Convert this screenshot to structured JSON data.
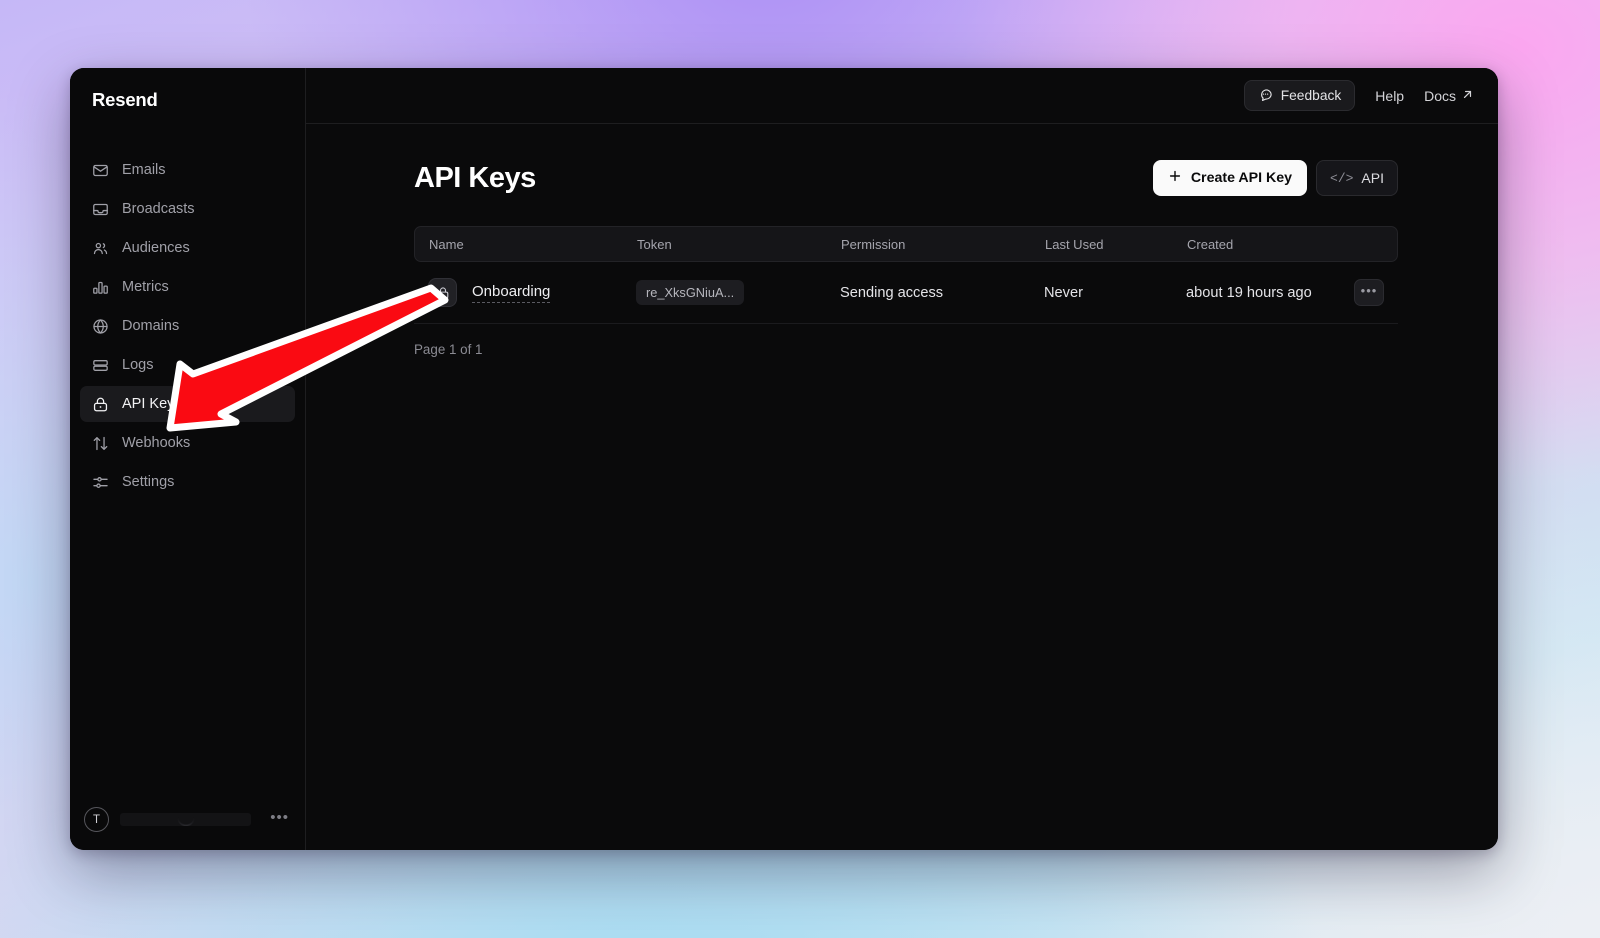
{
  "brand": {
    "name": "Resend"
  },
  "sidebar": {
    "items": [
      {
        "label": "Emails",
        "icon": "envelope-icon",
        "active": false
      },
      {
        "label": "Broadcasts",
        "icon": "inbox-icon",
        "active": false
      },
      {
        "label": "Audiences",
        "icon": "users-icon",
        "active": false
      },
      {
        "label": "Metrics",
        "icon": "bar-chart-icon",
        "active": false
      },
      {
        "label": "Domains",
        "icon": "globe-icon",
        "active": false
      },
      {
        "label": "Logs",
        "icon": "logs-icon",
        "active": false
      },
      {
        "label": "API Keys",
        "icon": "lock-icon",
        "active": true
      },
      {
        "label": "Webhooks",
        "icon": "arrows-updown-icon",
        "active": false
      },
      {
        "label": "Settings",
        "icon": "sliders-icon",
        "active": false
      }
    ],
    "footer": {
      "avatar_initial": "T",
      "account_name": "",
      "menu_label": "•••"
    }
  },
  "topbar": {
    "feedback_label": "Feedback",
    "feedback_icon": "chat-bubble-icon",
    "help_label": "Help",
    "docs_label": "Docs",
    "docs_icon": "external-link-icon"
  },
  "page": {
    "title": "API Keys",
    "create_button_label": "Create API Key",
    "create_button_icon": "plus-icon",
    "api_button_label": "API",
    "api_button_icon": "code-icon",
    "pagination": "Page 1 of 1"
  },
  "table": {
    "columns": [
      "Name",
      "Token",
      "Permission",
      "Last Used",
      "Created"
    ],
    "rows": [
      {
        "icon": "lock-icon",
        "name": "Onboarding",
        "token": "re_XksGNiuA...",
        "permission": "Sending access",
        "last_used": "Never",
        "created": "about 19 hours ago",
        "menu_label": "•••"
      }
    ]
  },
  "annotation": {
    "type": "arrow",
    "color": "#fa0a12",
    "outline_color": "#ffffff",
    "points_to": "sidebar-item-api-keys"
  },
  "colors": {
    "window_bg": "#0a0a0b",
    "sidebar_bg": "#09090a",
    "active_nav_bg": "#1a1a1d",
    "accent_button_bg": "#fafafa",
    "text_primary": "#ffffff",
    "text_muted": "#a0a0a8"
  }
}
